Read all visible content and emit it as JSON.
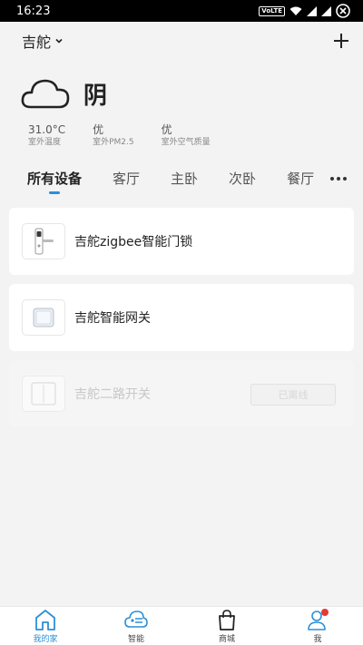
{
  "status_bar": {
    "time": "16:23",
    "network_badge": "VoLTE"
  },
  "header": {
    "home_name": "吉舵",
    "add_icon": "plus-icon",
    "dropdown_icon": "chevron-down-icon"
  },
  "weather": {
    "icon": "cloud-icon",
    "condition": "阴",
    "metrics": [
      {
        "value": "31.0°C",
        "label": "室外温度"
      },
      {
        "value": "优",
        "label": "室外PM2.5"
      },
      {
        "value": "优",
        "label": "室外空气质量"
      }
    ]
  },
  "tabs": [
    {
      "label": "所有设备",
      "active": true
    },
    {
      "label": "客厅"
    },
    {
      "label": "主卧"
    },
    {
      "label": "次卧"
    },
    {
      "label": "餐厅"
    }
  ],
  "devices": [
    {
      "name": "吉舵zigbee智能门锁",
      "icon": "door-lock-icon",
      "online": true
    },
    {
      "name": "吉舵智能网关",
      "icon": "gateway-icon",
      "online": true
    },
    {
      "name": "吉舵二路开关",
      "icon": "two-gang-switch-icon",
      "online": false,
      "status": "已离线"
    }
  ],
  "bottom_nav": [
    {
      "label": "我的家",
      "icon": "home-icon",
      "active": true
    },
    {
      "label": "智能",
      "icon": "smart-cloud-icon"
    },
    {
      "label": "商城",
      "icon": "shopping-bag-icon"
    },
    {
      "label": "我",
      "icon": "profile-icon",
      "badge_color": "#e53935"
    }
  ],
  "colors": {
    "accent": "#2c8fd6",
    "background": "#f3f3f3",
    "card": "#ffffff"
  }
}
